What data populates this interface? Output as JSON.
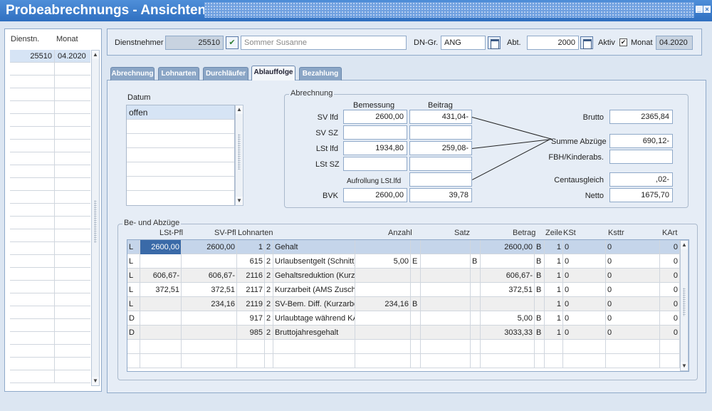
{
  "window": {
    "title": "Probeabrechnungs - Ansichten"
  },
  "left_list": {
    "headers": [
      "Dienstn.",
      "Monat"
    ],
    "rows": [
      {
        "dienstn": "25510",
        "monat": "04.2020"
      }
    ]
  },
  "header": {
    "dienstnehmer_label": "Dienstnehmer",
    "dienstnehmer_id": "25510",
    "dienstnehmer_name": "Sommer Susanne",
    "dngr_label": "DN-Gr.",
    "dngr_value": "ANG",
    "abt_label": "Abt.",
    "abt_value": "2000",
    "aktiv_label": "Aktiv",
    "aktiv_checked": "✔",
    "monat_label": "Monat",
    "monat_value": "04.2020"
  },
  "tabs": [
    "Abrechnung",
    "Lohnarten",
    "Durchläufer",
    "Ablauffolge",
    "Bezahlung"
  ],
  "datum": {
    "label": "Datum",
    "items": [
      "offen"
    ]
  },
  "abrechnung": {
    "title": "Abrechnung",
    "col_bemessung": "Bemessung",
    "col_beitrag": "Beitrag",
    "rows": [
      {
        "label": "SV lfd",
        "bemessung": "2600,00",
        "beitrag": "431,04-"
      },
      {
        "label": "SV SZ",
        "bemessung": "",
        "beitrag": ""
      },
      {
        "label": "LSt lfd",
        "bemessung": "1934,80",
        "beitrag": "259,08-"
      },
      {
        "label": "LSt SZ",
        "bemessung": "",
        "beitrag": ""
      }
    ],
    "aufrollung_label": "Aufrollung LSt.lfd",
    "aufrollung_value": "",
    "bvk_label": "BVK",
    "bvk_bemessung": "2600,00",
    "bvk_beitrag": "39,78",
    "brutto_label": "Brutto",
    "brutto": "2365,84",
    "summe_label": "Summe Abzüge",
    "summe": "690,12-",
    "fbh_label": "FBH/Kinderabs.",
    "fbh": "",
    "cent_label": "Centausgleich",
    "cent": ",02-",
    "netto_label": "Netto",
    "netto": "1675,70"
  },
  "abzuege": {
    "title": "Be- und Abzüge",
    "headers": [
      "LSt-Pfl",
      "SV-Pfl",
      "Lohnarten",
      "Anzahl",
      "Satz",
      "Betrag",
      "Zeile",
      "KSt",
      "Ksttr",
      "KArt"
    ],
    "rows": [
      {
        "t": "L",
        "lst": "2600,00",
        "sv": "2600,00",
        "la": "1",
        "k": "2",
        "name": "Gehalt",
        "anz": "",
        "e": "",
        "satz": "",
        "sb": "",
        "betrag": "2600,00",
        "bb": "B",
        "zeile": "1",
        "kst": "0",
        "ksttr": "0",
        "kart": "0"
      },
      {
        "t": "L",
        "lst": "",
        "sv": "",
        "la": "615",
        "k": "2",
        "name": "Urlaubsentgelt (Schnitt)",
        "anz": "5,00",
        "e": "E",
        "satz": "",
        "sb": "B",
        "betrag": "",
        "bb": "B",
        "zeile": "1",
        "kst": "0",
        "ksttr": "0",
        "kart": "0"
      },
      {
        "t": "L",
        "lst": "606,67-",
        "sv": "606,67-",
        "la": "2116",
        "k": "2",
        "name": "Gehaltsreduktion (Kurzarbeit)",
        "anz": "",
        "e": "",
        "satz": "",
        "sb": "",
        "betrag": "606,67-",
        "bb": "B",
        "zeile": "1",
        "kst": "0",
        "ksttr": "0",
        "kart": "0"
      },
      {
        "t": "L",
        "lst": "372,51",
        "sv": "372,51",
        "la": "2117",
        "k": "2",
        "name": "Kurzarbeit (AMS Zuschuss)",
        "anz": "",
        "e": "",
        "satz": "",
        "sb": "",
        "betrag": "372,51",
        "bb": "B",
        "zeile": "1",
        "kst": "0",
        "ksttr": "0",
        "kart": "0"
      },
      {
        "t": "L",
        "lst": "",
        "sv": "234,16",
        "la": "2119",
        "k": "2",
        "name": "SV-Bem. Diff. (Kurzarbeit)",
        "anz": "234,16",
        "e": "B",
        "satz": "",
        "sb": "",
        "betrag": "",
        "bb": "",
        "zeile": "1",
        "kst": "0",
        "ksttr": "0",
        "kart": "0"
      },
      {
        "t": "D",
        "lst": "",
        "sv": "",
        "la": "917",
        "k": "2",
        "name": "Urlaubtage während KA",
        "anz": "",
        "e": "",
        "satz": "",
        "sb": "",
        "betrag": "5,00",
        "bb": "B",
        "zeile": "1",
        "kst": "0",
        "ksttr": "0",
        "kart": "0"
      },
      {
        "t": "D",
        "lst": "",
        "sv": "",
        "la": "985",
        "k": "2",
        "name": "Bruttojahresgehalt",
        "anz": "",
        "e": "",
        "satz": "",
        "sb": "",
        "betrag": "3033,33",
        "bb": "B",
        "zeile": "1",
        "kst": "0",
        "ksttr": "0",
        "kart": "0"
      }
    ]
  }
}
